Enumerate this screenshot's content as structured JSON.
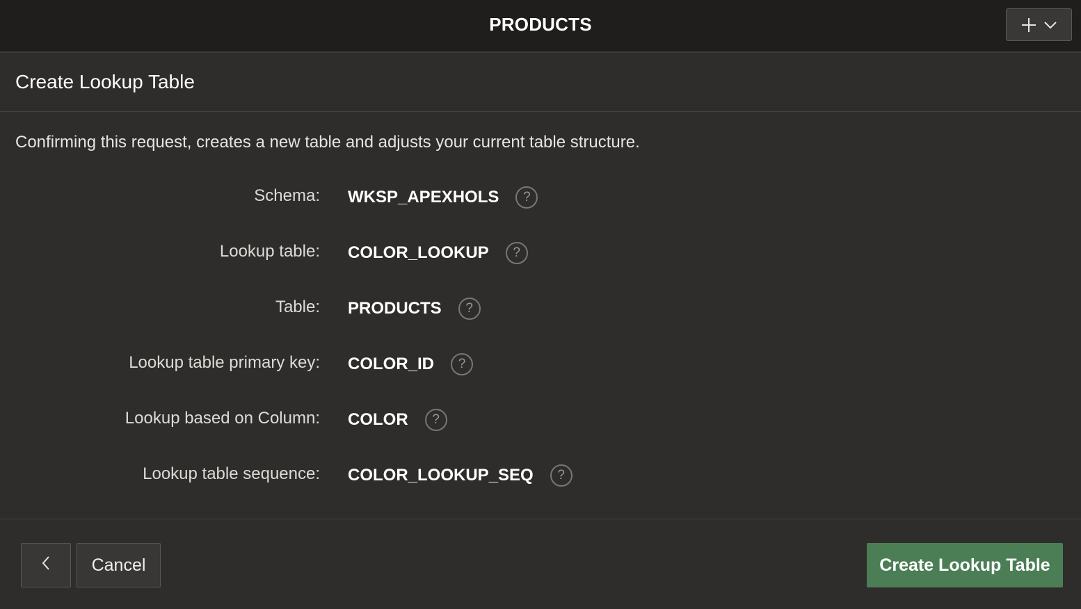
{
  "header": {
    "title": "PRODUCTS",
    "add_menu_icon": "plus-icon",
    "add_menu_chevron_icon": "chevron-down-icon"
  },
  "dialog": {
    "title": "Create Lookup Table",
    "description": "Confirming this request, creates a new table and adjusts your current table structure."
  },
  "fields": [
    {
      "label": "Schema:",
      "value": "WKSP_APEXHOLS",
      "help": "?"
    },
    {
      "label": "Lookup table:",
      "value": "COLOR_LOOKUP",
      "help": "?"
    },
    {
      "label": "Table:",
      "value": "PRODUCTS",
      "help": "?"
    },
    {
      "label": "Lookup table primary key:",
      "value": "COLOR_ID",
      "help": "?"
    },
    {
      "label": "Lookup based on Column:",
      "value": "COLOR",
      "help": "?"
    },
    {
      "label": "Lookup table sequence:",
      "value": "COLOR_LOOKUP_SEQ",
      "help": "?"
    }
  ],
  "footer": {
    "back_icon": "chevron-left-icon",
    "cancel_label": "Cancel",
    "create_label": "Create Lookup Table"
  },
  "colors": {
    "background": "#2f2d2b",
    "topbar": "#1f1e1d",
    "primary_button": "#4c7e56"
  }
}
